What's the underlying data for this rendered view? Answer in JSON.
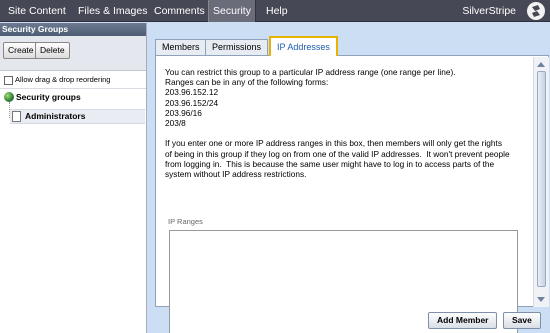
{
  "topnav": {
    "items": [
      "Site Content",
      "Files & Images",
      "Comments",
      "Security",
      "Help"
    ],
    "active": "Security",
    "brand": "SilverStripe"
  },
  "left": {
    "title": "Security Groups",
    "buttons": {
      "create": "Create",
      "delete": "Delete"
    },
    "drag_label": "Allow drag & drop reordering",
    "tree": {
      "root": "Security groups",
      "children": [
        "Administrators"
      ]
    }
  },
  "tabs": [
    "Members",
    "Permissions",
    "IP Addresses"
  ],
  "active_tab": "IP Addresses",
  "content": {
    "description": "You can restrict this group to a particular IP address range (one range per line).\nRanges can be in any of the following forms:\n203.96.152.12\n203.96.152/24\n203.96/16\n203/8\n\nIf you enter one or more IP address ranges in this box, then members will only get the rights\nof being in this group if they log on from one of the valid IP addresses.  It won't prevent people\nfrom logging in.  This is because the same user might have to log in to access parts of the\nsystem without IP address restrictions.",
    "ip_ranges_label": "IP Ranges",
    "ip_ranges_value": ""
  },
  "footer": {
    "add_member": "Add Member",
    "save": "Save"
  },
  "colors": {
    "nav_bg": "#474855",
    "nav_active": "#6a6d79",
    "tab_active_border": "#e9b100",
    "panel_bg": "#ccdef3"
  }
}
